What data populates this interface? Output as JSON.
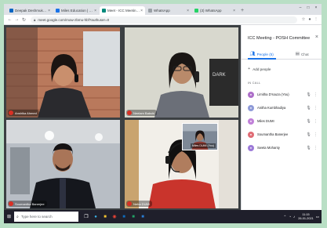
{
  "browser": {
    "tabs": [
      {
        "label": "Deepak Deshmukh | Linkedin",
        "color": "#0a66c2",
        "active": false
      },
      {
        "label": "Miles Education | People",
        "color": "#1a73e8",
        "active": false
      },
      {
        "label": "Meet - ICC Meeting - POSH",
        "color": "#00897b",
        "active": true
      },
      {
        "label": "WhatsApp",
        "color": "#9aa0a6",
        "active": false
      },
      {
        "label": "(3) WhatsApp",
        "color": "#25d366",
        "active": false
      }
    ],
    "url": "meet.google.com/mow-zbmu-hbf?authuser=0"
  },
  "tiles": [
    {
      "name": "Anshika Ahmed",
      "role": "woman-headset-red-brick"
    },
    {
      "name": "Neelam Bakshi",
      "role": "woman-glasses-phone"
    },
    {
      "name": "Soumantha Banerjee",
      "role": "man-black-jacket"
    },
    {
      "name": "Neha DUMI",
      "role": "woman-headset-orange"
    }
  ],
  "pip": {
    "label": "Miles DUMI (You)"
  },
  "panel": {
    "title": "ICC Meeting - POSH Committee",
    "tab_people": "People (5)",
    "tab_chat": "Chat",
    "add_people": "Add people",
    "in_call": "IN CALL",
    "participants": [
      {
        "name": "Limitha D'souza (You)",
        "color": "#ad6fc9"
      },
      {
        "name": "Anitha Kumbhadiya",
        "color": "#8e9ad8"
      },
      {
        "name": "Miles DUMI",
        "color": "#c080d8"
      },
      {
        "name": "Soumantha Banerjee",
        "color": "#e06c75"
      },
      {
        "name": "Sweta Mohanty",
        "color": "#9c7ad8"
      }
    ]
  },
  "taskbar": {
    "search_placeholder": "Type here to search",
    "time": "11:15",
    "date": "26-01-2021"
  }
}
